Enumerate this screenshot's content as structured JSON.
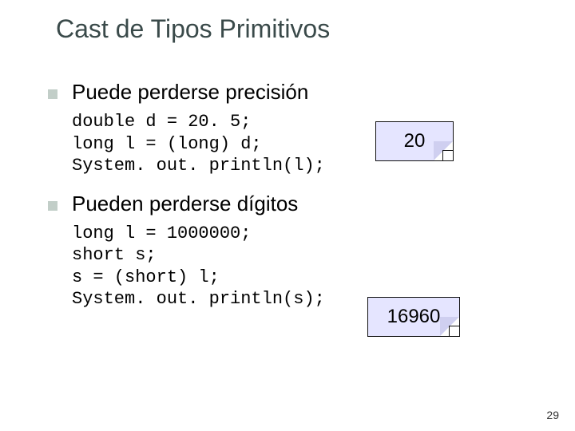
{
  "title": "Cast de Tipos Primitivos",
  "sections": [
    {
      "heading": "Puede perderse precisión",
      "code": "double d = 20. 5;\nlong l = (long) d;\nSystem. out. println(l);",
      "note": "20"
    },
    {
      "heading": "Pueden perderse dígitos",
      "code": "long l = 1000000;\nshort s;\ns = (short) l;\nSystem. out. println(s);",
      "note": "16960"
    }
  ],
  "page_number": "29"
}
